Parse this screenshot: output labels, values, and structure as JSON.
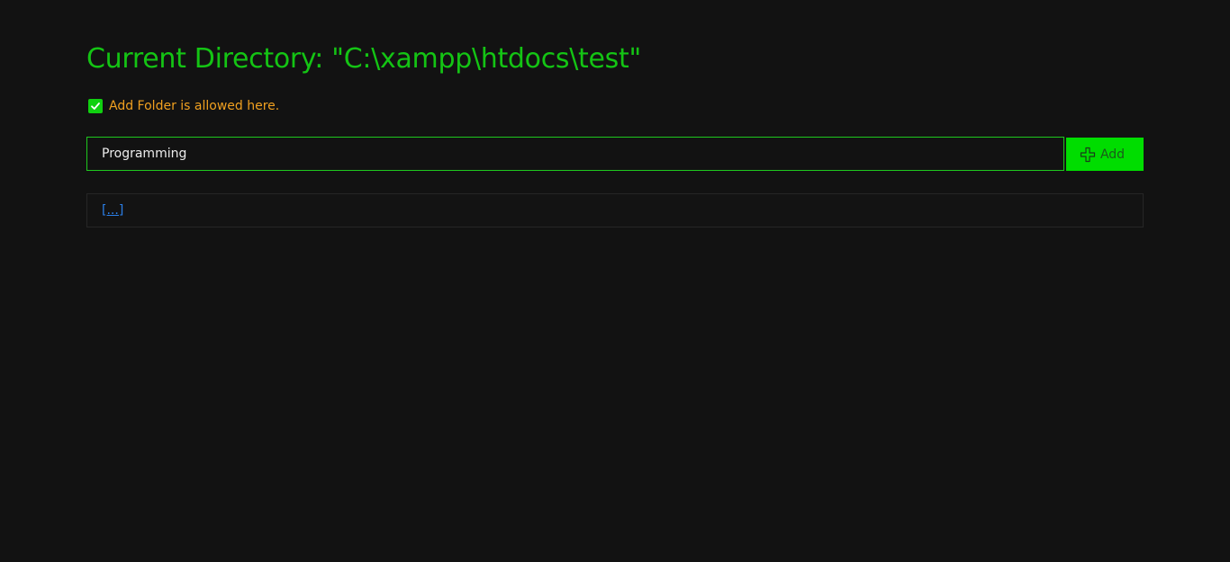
{
  "header": {
    "title": "Current Directory: \"C:\\xampp\\htdocs\\test\""
  },
  "notice": {
    "icon": "check-icon",
    "text": "Add Folder is allowed here."
  },
  "add_form": {
    "input_value": "Programming",
    "button_icon": "plus-icon",
    "button_label": "Add"
  },
  "listing": {
    "items": [
      {
        "label": "[...]"
      }
    ]
  },
  "colors": {
    "background": "#121212",
    "title": "#14c414",
    "notice": "#f0a020",
    "accent": "#00dd00",
    "link": "#2b7fe8"
  }
}
